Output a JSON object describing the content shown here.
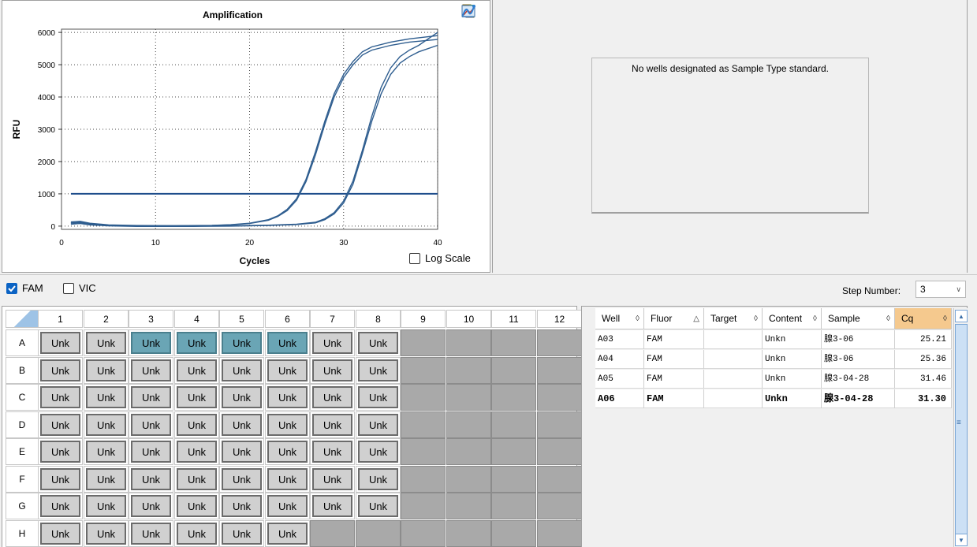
{
  "chart": {
    "title": "Amplification",
    "xlabel": "Cycles",
    "ylabel": "RFU",
    "log_scale_label": "Log Scale",
    "log_scale_checked": false,
    "toolbar_icons": [
      "copy-icon",
      "chart-tools-icon",
      "export-icon",
      "image-icon",
      "trace-icon"
    ]
  },
  "chart_data": {
    "type": "line",
    "title": "Amplification",
    "xlabel": "Cycles",
    "ylabel": "RFU",
    "xlim": [
      0,
      40
    ],
    "ylim": [
      -100,
      6100
    ],
    "xticks": [
      0,
      10,
      20,
      30,
      40
    ],
    "yticks": [
      0,
      1000,
      2000,
      3000,
      4000,
      5000,
      6000
    ],
    "grid": "dotted",
    "threshold": 1000,
    "series": [
      {
        "values": [
          [
            1,
            130
          ],
          [
            2,
            150
          ],
          [
            3,
            90
          ],
          [
            5,
            40
          ],
          [
            8,
            20
          ],
          [
            12,
            15
          ],
          [
            16,
            25
          ],
          [
            18,
            45
          ],
          [
            20,
            90
          ],
          [
            22,
            200
          ],
          [
            23,
            320
          ],
          [
            24,
            520
          ],
          [
            25,
            850
          ],
          [
            26,
            1450
          ],
          [
            27,
            2300
          ],
          [
            28,
            3250
          ],
          [
            29,
            4100
          ],
          [
            30,
            4700
          ],
          [
            31,
            5100
          ],
          [
            32,
            5400
          ],
          [
            33,
            5550
          ],
          [
            35,
            5700
          ],
          [
            37,
            5800
          ],
          [
            40,
            5900
          ]
        ]
      },
      {
        "values": [
          [
            1,
            100
          ],
          [
            2,
            120
          ],
          [
            3,
            70
          ],
          [
            5,
            30
          ],
          [
            8,
            10
          ],
          [
            12,
            10
          ],
          [
            16,
            20
          ],
          [
            18,
            40
          ],
          [
            20,
            80
          ],
          [
            22,
            180
          ],
          [
            23,
            300
          ],
          [
            24,
            480
          ],
          [
            25,
            800
          ],
          [
            26,
            1380
          ],
          [
            27,
            2200
          ],
          [
            28,
            3150
          ],
          [
            29,
            4000
          ],
          [
            30,
            4600
          ],
          [
            31,
            5000
          ],
          [
            32,
            5300
          ],
          [
            33,
            5450
          ],
          [
            35,
            5600
          ],
          [
            37,
            5700
          ],
          [
            40,
            5780
          ]
        ]
      },
      {
        "values": [
          [
            1,
            90
          ],
          [
            2,
            110
          ],
          [
            3,
            60
          ],
          [
            5,
            20
          ],
          [
            8,
            0
          ],
          [
            14,
            0
          ],
          [
            18,
            10
          ],
          [
            22,
            30
          ],
          [
            25,
            60
          ],
          [
            27,
            120
          ],
          [
            28,
            230
          ],
          [
            29,
            420
          ],
          [
            30,
            780
          ],
          [
            31,
            1400
          ],
          [
            32,
            2350
          ],
          [
            33,
            3400
          ],
          [
            34,
            4300
          ],
          [
            35,
            4900
          ],
          [
            36,
            5250
          ],
          [
            37,
            5450
          ],
          [
            38,
            5600
          ],
          [
            40,
            6000
          ]
        ]
      },
      {
        "values": [
          [
            1,
            60
          ],
          [
            2,
            80
          ],
          [
            3,
            40
          ],
          [
            5,
            10
          ],
          [
            8,
            -10
          ],
          [
            14,
            -10
          ],
          [
            18,
            0
          ],
          [
            22,
            20
          ],
          [
            25,
            50
          ],
          [
            27,
            100
          ],
          [
            28,
            200
          ],
          [
            29,
            380
          ],
          [
            30,
            720
          ],
          [
            31,
            1300
          ],
          [
            32,
            2250
          ],
          [
            33,
            3250
          ],
          [
            34,
            4100
          ],
          [
            35,
            4700
          ],
          [
            36,
            5050
          ],
          [
            37,
            5250
          ],
          [
            38,
            5400
          ],
          [
            40,
            5600
          ]
        ]
      }
    ]
  },
  "std_curve": {
    "message": "No wells designated as Sample Type standard."
  },
  "fluors": [
    {
      "label": "FAM",
      "checked": true
    },
    {
      "label": "VIC",
      "checked": false
    }
  ],
  "step": {
    "label": "Step Number:",
    "value": "3"
  },
  "plate": {
    "cols": [
      "1",
      "2",
      "3",
      "4",
      "5",
      "6",
      "7",
      "8",
      "9",
      "10",
      "11",
      "12"
    ],
    "rows": [
      "A",
      "B",
      "C",
      "D",
      "E",
      "F",
      "G",
      "H"
    ],
    "well_label": "Unk",
    "filled_cols_per_row": [
      8,
      8,
      8,
      8,
      8,
      8,
      8,
      6
    ],
    "selected": [
      "A3",
      "A4",
      "A5",
      "A6"
    ]
  },
  "table": {
    "headers": [
      "Well",
      "Fluor",
      "Target",
      "Content",
      "Sample",
      "Cq"
    ],
    "sort_marks": [
      "◊",
      "△",
      "◊",
      "◊",
      "◊",
      "◊"
    ],
    "rows": [
      [
        "A03",
        "FAM",
        "",
        "Unkn",
        "腺3-06",
        "25.21"
      ],
      [
        "A04",
        "FAM",
        "",
        "Unkn",
        "腺3-06",
        "25.36"
      ],
      [
        "A05",
        "FAM",
        "",
        "Unkn",
        "腺3-04-28",
        "31.46"
      ],
      [
        "A06",
        "FAM",
        "",
        "Unkn",
        "腺3-04-28",
        "31.30"
      ]
    ],
    "bold_row": 3
  }
}
